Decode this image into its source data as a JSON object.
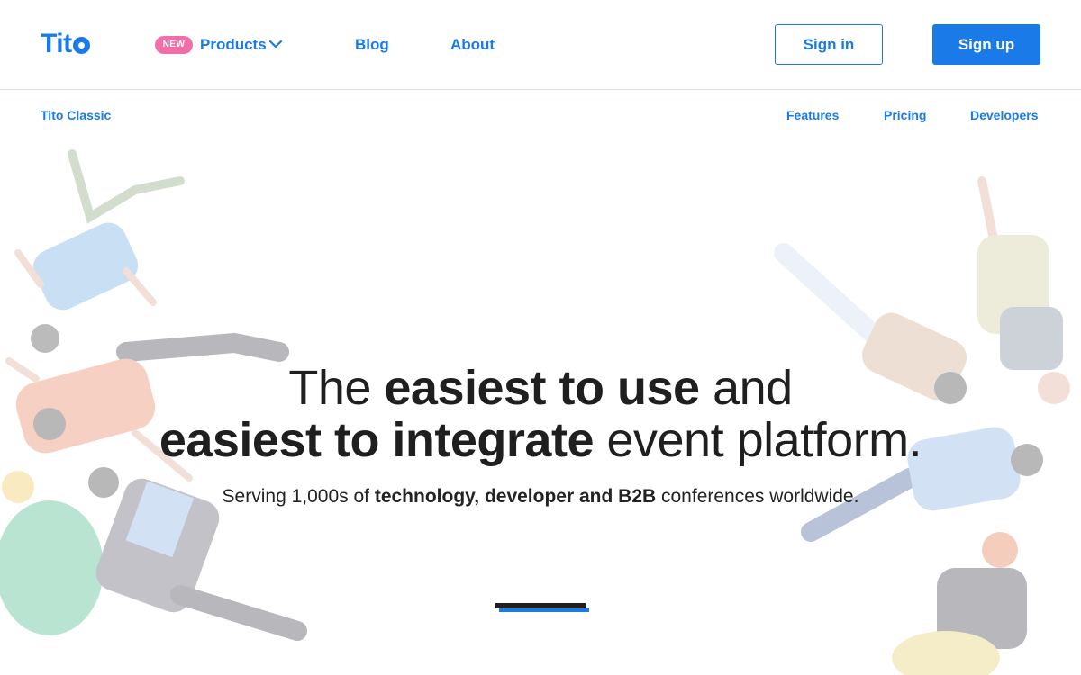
{
  "header": {
    "logo_text": "Tit",
    "badge": "NEW",
    "nav": {
      "products": "Products",
      "blog": "Blog",
      "about": "About"
    },
    "sign_in": "Sign in",
    "sign_up": "Sign up"
  },
  "subnav": {
    "classic": "Tito Classic",
    "features": "Features",
    "pricing": "Pricing",
    "developers": "Developers"
  },
  "hero": {
    "line1_pre": "The ",
    "line1_bold": "easiest to use",
    "line1_post": " and",
    "line2_bold": "easiest to integrate",
    "line2_post": " event platform.",
    "sub_pre": "Serving 1,000s of ",
    "sub_bold": "technology, developer and B2B",
    "sub_post": " conferences worldwide."
  },
  "colors": {
    "accent": "#1a7be8",
    "badge": "#f16fa9",
    "text": "#1f1f1f"
  },
  "icons": {
    "products_dropdown": "chevron-down-icon"
  }
}
